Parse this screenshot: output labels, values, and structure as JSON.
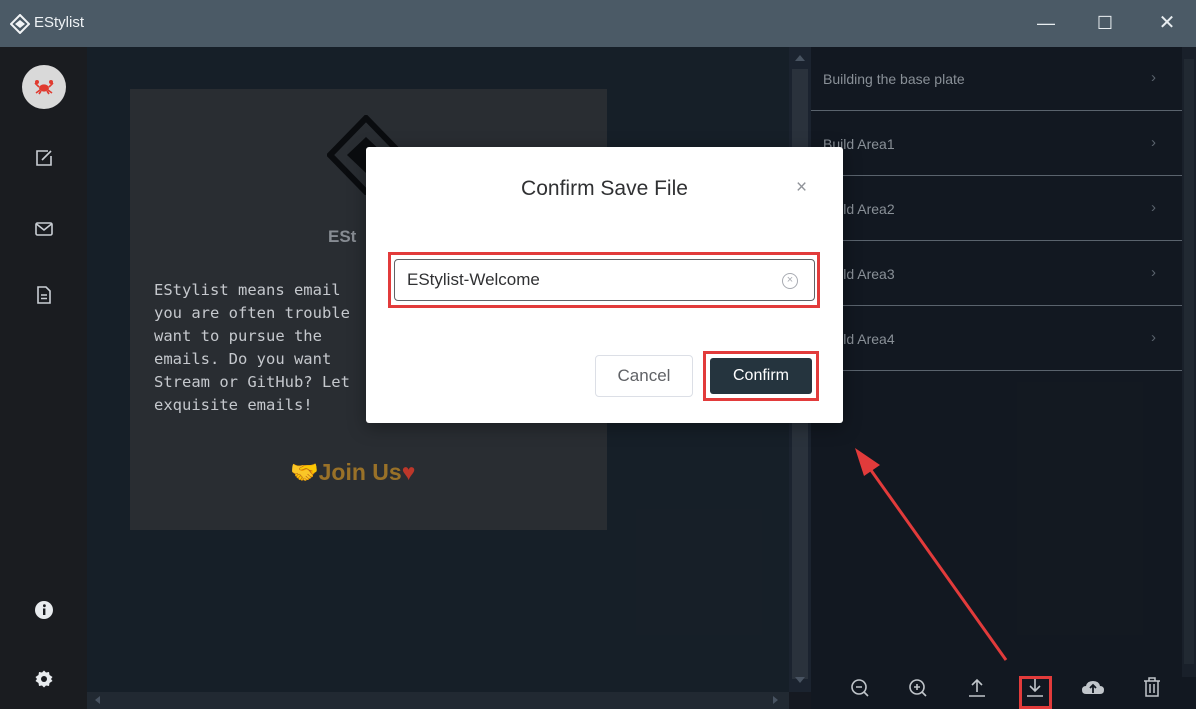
{
  "window": {
    "title": "EStylist",
    "minimize_glyph": "—",
    "maximize_glyph": "☐",
    "close_glyph": "✕"
  },
  "sidebar": {
    "items": [
      {
        "icon": "crab-avatar-icon"
      },
      {
        "icon": "edit-icon"
      },
      {
        "icon": "mail-icon"
      },
      {
        "icon": "document-icon"
      },
      {
        "icon": "info-icon"
      },
      {
        "icon": "gear-icon"
      }
    ]
  },
  "preview": {
    "brand_name": "ESt",
    "description": "EStylist means email\nyou are often trouble\nwant to pursue the\nemails. Do you want\nStream or GitHub? Let\nexquisite emails!",
    "join_text": "Join Us"
  },
  "blocks": [
    {
      "label": "Building the base plate"
    },
    {
      "label": "Build Area1"
    },
    {
      "label": "Build Area2"
    },
    {
      "label": "Build Area3"
    },
    {
      "label": "Build Area4"
    }
  ],
  "chevron": "›",
  "toolbar": {
    "icons": [
      "zoom-out-icon",
      "zoom-in-icon",
      "upload-icon",
      "download-icon",
      "cloud-upload-icon",
      "trash-icon"
    ]
  },
  "modal": {
    "title": "Confirm Save File",
    "close_glyph": "×",
    "input_value": "EStylist-Welcome",
    "clear_glyph": "×",
    "cancel_label": "Cancel",
    "confirm_label": "Confirm"
  },
  "colors": {
    "titlebar": "#4b5a66",
    "confirm_button": "#25343e",
    "annotation_red": "#e23b3b",
    "join_gold": "#9d7429"
  }
}
